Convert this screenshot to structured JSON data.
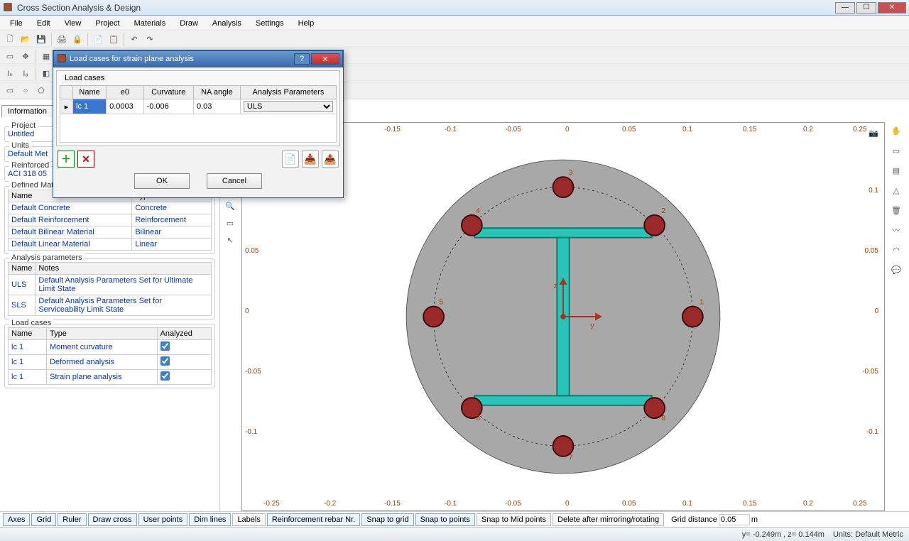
{
  "window": {
    "title": "Cross Section Analysis & Design"
  },
  "menu": [
    "File",
    "Edit",
    "View",
    "Project",
    "Materials",
    "Draw",
    "Analysis",
    "Settings",
    "Help"
  ],
  "panel_tab": "Information",
  "project": {
    "label": "Project",
    "value": "Untitled"
  },
  "units": {
    "label": "Units",
    "value": "Default Met"
  },
  "reinforced": {
    "label": "Reinforced",
    "value": "ACI 318 05"
  },
  "defined_materials": {
    "title": "Defined Materials",
    "headers": [
      "Name",
      "Type"
    ],
    "rows": [
      {
        "name": "Default Concrete",
        "type": "Concrete"
      },
      {
        "name": "Default Reinforcement",
        "type": "Reinforcement"
      },
      {
        "name": "Default Bilinear Material",
        "type": "Bilinear"
      },
      {
        "name": "Default Linear Material",
        "type": "Linear"
      }
    ]
  },
  "analysis_parameters": {
    "title": "Analysis parameters",
    "headers": [
      "Name",
      "Notes"
    ],
    "rows": [
      {
        "name": "ULS",
        "notes": "Default Analysis Parameters Set for Ultimate Limit State"
      },
      {
        "name": "SLS",
        "notes": "Default Analysis Parameters Set for Serviceability Limit State"
      }
    ]
  },
  "load_cases_panel": {
    "title": "Load cases",
    "headers": [
      "Name",
      "Type",
      "Analyzed"
    ],
    "rows": [
      {
        "name": "lc 1",
        "type": "Moment curvature",
        "analyzed": true
      },
      {
        "name": "lc 1",
        "type": "Deformed analysis",
        "analyzed": true
      },
      {
        "name": "lc 1",
        "type": "Strain plane analysis",
        "analyzed": true
      }
    ]
  },
  "status_toggles": [
    "Axes",
    "Grid",
    "Ruler",
    "Draw cross",
    "User points",
    "Dim lines",
    "Labels",
    "Reinforcement rebar Nr.",
    "Snap to grid",
    "Snap to points",
    "Snap to Mid points",
    "Delete after mirroring/rotating"
  ],
  "grid_distance_label": "Grid distance",
  "grid_distance_value": "0.05",
  "grid_distance_unit": "m",
  "statusbar": {
    "coords": "y= -0.249m , z= 0.144m",
    "units": "Units: Default Metric"
  },
  "dialog": {
    "title": "Load cases for strain plane analysis",
    "group_title": "Load cases",
    "headers": [
      "",
      "Name",
      "e0",
      "Curvature",
      "NA angle",
      "Analysis Parameters"
    ],
    "row": {
      "name": "lc 1",
      "e0": "0.0003",
      "curvature": "-0.006",
      "na_angle": "0.03",
      "analysis": "ULS"
    },
    "ok": "OK",
    "cancel": "Cancel"
  },
  "axes": {
    "x_vals": [
      "-0.25",
      "-0.2",
      "-0.15",
      "-0.1",
      "-0.05",
      "0",
      "0.05",
      "0.1",
      "0.15",
      "0.2",
      "0.25"
    ],
    "y_vals": [
      "0.1",
      "0.05",
      "0",
      "-0.05",
      "-0.1"
    ]
  },
  "rebars": [
    "1",
    "2",
    "3",
    "4",
    "5",
    "6",
    "7",
    "8"
  ],
  "section_axes": {
    "y": "y",
    "z": "z"
  }
}
